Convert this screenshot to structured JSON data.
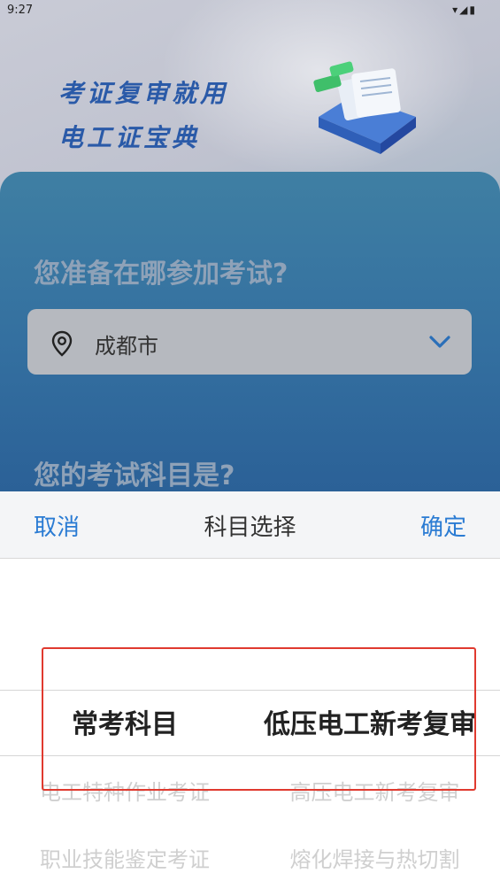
{
  "status_bar": {
    "time": "9:27",
    "icons": [
      "wifi-icon",
      "signal-icon",
      "battery-icon"
    ]
  },
  "hero": {
    "slogan_line1": "考证复审就用",
    "slogan_line2": "电工证宝典"
  },
  "form": {
    "question_location": "您准备在哪参加考试?",
    "city": "成都市",
    "question_subject": "您的考试科目是?"
  },
  "picker": {
    "cancel_label": "取消",
    "title": "科目选择",
    "confirm_label": "确定",
    "left_column": [
      "常考科目",
      "电工特种作业考证",
      "职业技能鉴定考证"
    ],
    "right_column": [
      "低压电工新考复审",
      "高压电工新考复审",
      "熔化焊接与热切割"
    ]
  },
  "colors": {
    "accent": "#2a7bd3",
    "highlight_box": "#e03a2f",
    "slogan": "#2a5aa8"
  }
}
